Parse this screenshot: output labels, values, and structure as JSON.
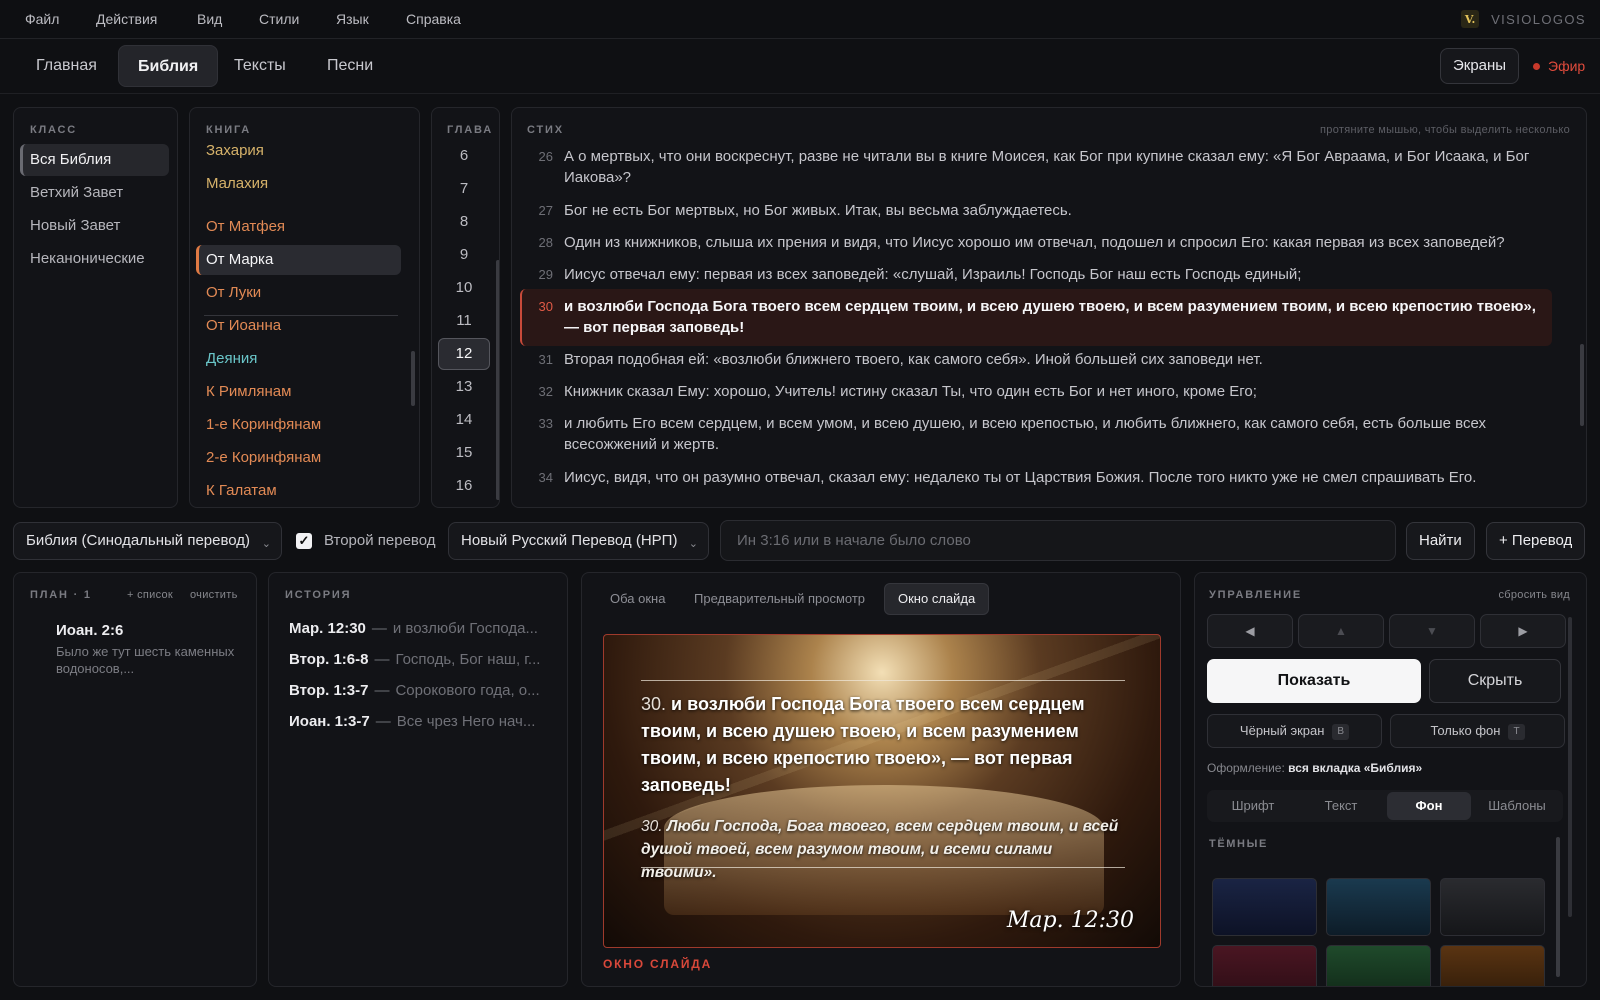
{
  "app": {
    "brand": "VISIOLOGOS",
    "logo_letter": "V."
  },
  "menu": [
    "Файл",
    "Действия",
    "Вид",
    "Стили",
    "Язык",
    "Справка"
  ],
  "tabs": [
    "Главная",
    "Библия",
    "Тексты",
    "Песни"
  ],
  "header": {
    "screens": "Экраны",
    "air": "Эфир"
  },
  "class_panel": {
    "title": "КЛАСС",
    "items": [
      "Вся Библия",
      "Ветхий Завет",
      "Новый Завет",
      "Неканонические"
    ]
  },
  "book_panel": {
    "title": "КНИГА",
    "items": [
      "Захария",
      "Малахия",
      "От Матфея",
      "От Марка",
      "От Луки",
      "От Иоанна",
      "Деяния",
      "К Римлянам",
      "1-е Коринфянам",
      "2-е Коринфянам",
      "К Галатам"
    ]
  },
  "chapter_panel": {
    "title": "ГЛАВА",
    "items": [
      "6",
      "7",
      "8",
      "9",
      "10",
      "11",
      "12",
      "13",
      "14",
      "15",
      "16"
    ]
  },
  "verse_panel": {
    "title": "СТИХ",
    "hint": "протяните мышью, чтобы выделить несколько",
    "verses": [
      {
        "n": "26",
        "text": "А о мертвых, что они воскреснут, разве не читали вы в книге Моисея, как Бог при купине сказал ему: «Я Бог Авраама, и Бог Исаака, и Бог Иакова»?"
      },
      {
        "n": "27",
        "text": "Бог не есть Бог мертвых, но Бог живых. Итак, вы весьма заблуждаетесь."
      },
      {
        "n": "28",
        "text": "Один из книжников, слыша их прения и видя, что Иисус хорошо им отвечал, подошел и спросил Его: какая первая из всех заповедей?"
      },
      {
        "n": "29",
        "text": "Иисус отвечал ему: первая из всех заповедей: «слушай, Израиль! Господь Бог наш есть Господь единый;"
      },
      {
        "n": "30",
        "text": "и возлюби Господа Бога твоего всем сердцем твоим, и всею душею твоею, и всем разумением твоим, и всею крепостию твоею», — вот первая заповедь!"
      },
      {
        "n": "31",
        "text": "Вторая подобная ей: «возлюби ближнего твоего, как самого себя». Иной большей сих заповеди нет."
      },
      {
        "n": "32",
        "text": "Книжник сказал Ему: хорошо, Учитель! истину сказал Ты, что один есть Бог и нет иного, кроме Его;"
      },
      {
        "n": "33",
        "text": "и любить Его всем сердцем, и всем умом, и всею душею, и всею крепостью, и любить ближнего, как самого себя, есть больше всех всесожжений и жертв."
      },
      {
        "n": "34",
        "text": "Иисус, видя, что он разумно отвечал, сказал ему: недалеко ты от Царствия Божия. После того никто уже не смел спрашивать Его."
      }
    ]
  },
  "toolbar": {
    "translation": "Библия (Синодальный перевод)",
    "second_label": "Второй перевод",
    "second_translation": "Новый Русский Перевод (НРП)",
    "search_placeholder": "Ин 3:16 или в начале было слово",
    "find": "Найти",
    "add_translation": "+ Перевод"
  },
  "plan": {
    "title": "ПЛАН · 1",
    "add_list": "+ список",
    "clear": "очистить",
    "item_ref": "Иоан. 2:6",
    "item_text": "Было же тут шесть каменных водоносов,..."
  },
  "history": {
    "title": "ИСТОРИЯ",
    "items": [
      {
        "ref": "Мар. 12:30",
        "text": "и возлюби Господа..."
      },
      {
        "ref": "Втор. 1:6-8",
        "text": "Господь, Бог наш, г..."
      },
      {
        "ref": "Втор. 1:3-7",
        "text": "Сорокового года, о..."
      },
      {
        "ref": "Иоан. 1:3-7",
        "text": "Все чрез Него нач..."
      }
    ]
  },
  "preview": {
    "tabs": [
      "Оба окна",
      "Предварительный просмотр",
      "Окно слайда"
    ],
    "main_num": "30.",
    "main_text": "и возлюби Господа Бога твоего всем сердцем твоим, и всею душею твоею, и всем разумением твоим, и всею крепостию твоею», — вот первая заповедь!",
    "second_num": "30.",
    "second_text": "Люби Господа, Бога твоего, всем сердцем твоим, и всей душой твоей, всем разумом твоим, и всеми силами твоими».",
    "reference": "Мар. 12:30",
    "caption": "ОКНО СЛАЙДА"
  },
  "control": {
    "title": "УПРАВЛЕНИЕ",
    "reset": "сбросить вид",
    "arrows": [
      "◀",
      "▲",
      "▼",
      "▶"
    ],
    "show": "Показать",
    "hide": "Скрыть",
    "black": "Чёрный экран",
    "black_key": "B",
    "bg_only": "Только фон",
    "bg_key": "T",
    "style_label": "Оформление:",
    "style_value": "вся вкладка «Библия»",
    "segments": [
      "Шрифт",
      "Текст",
      "Фон",
      "Шаблоны"
    ],
    "group": "ТЁМНЫЕ"
  },
  "colors": {
    "accent": "#c84a3a",
    "book_active": "#e07a44",
    "old_testament_books": "#d6b26a",
    "gospels": "#e28a55",
    "acts": "#6ac6c9"
  }
}
